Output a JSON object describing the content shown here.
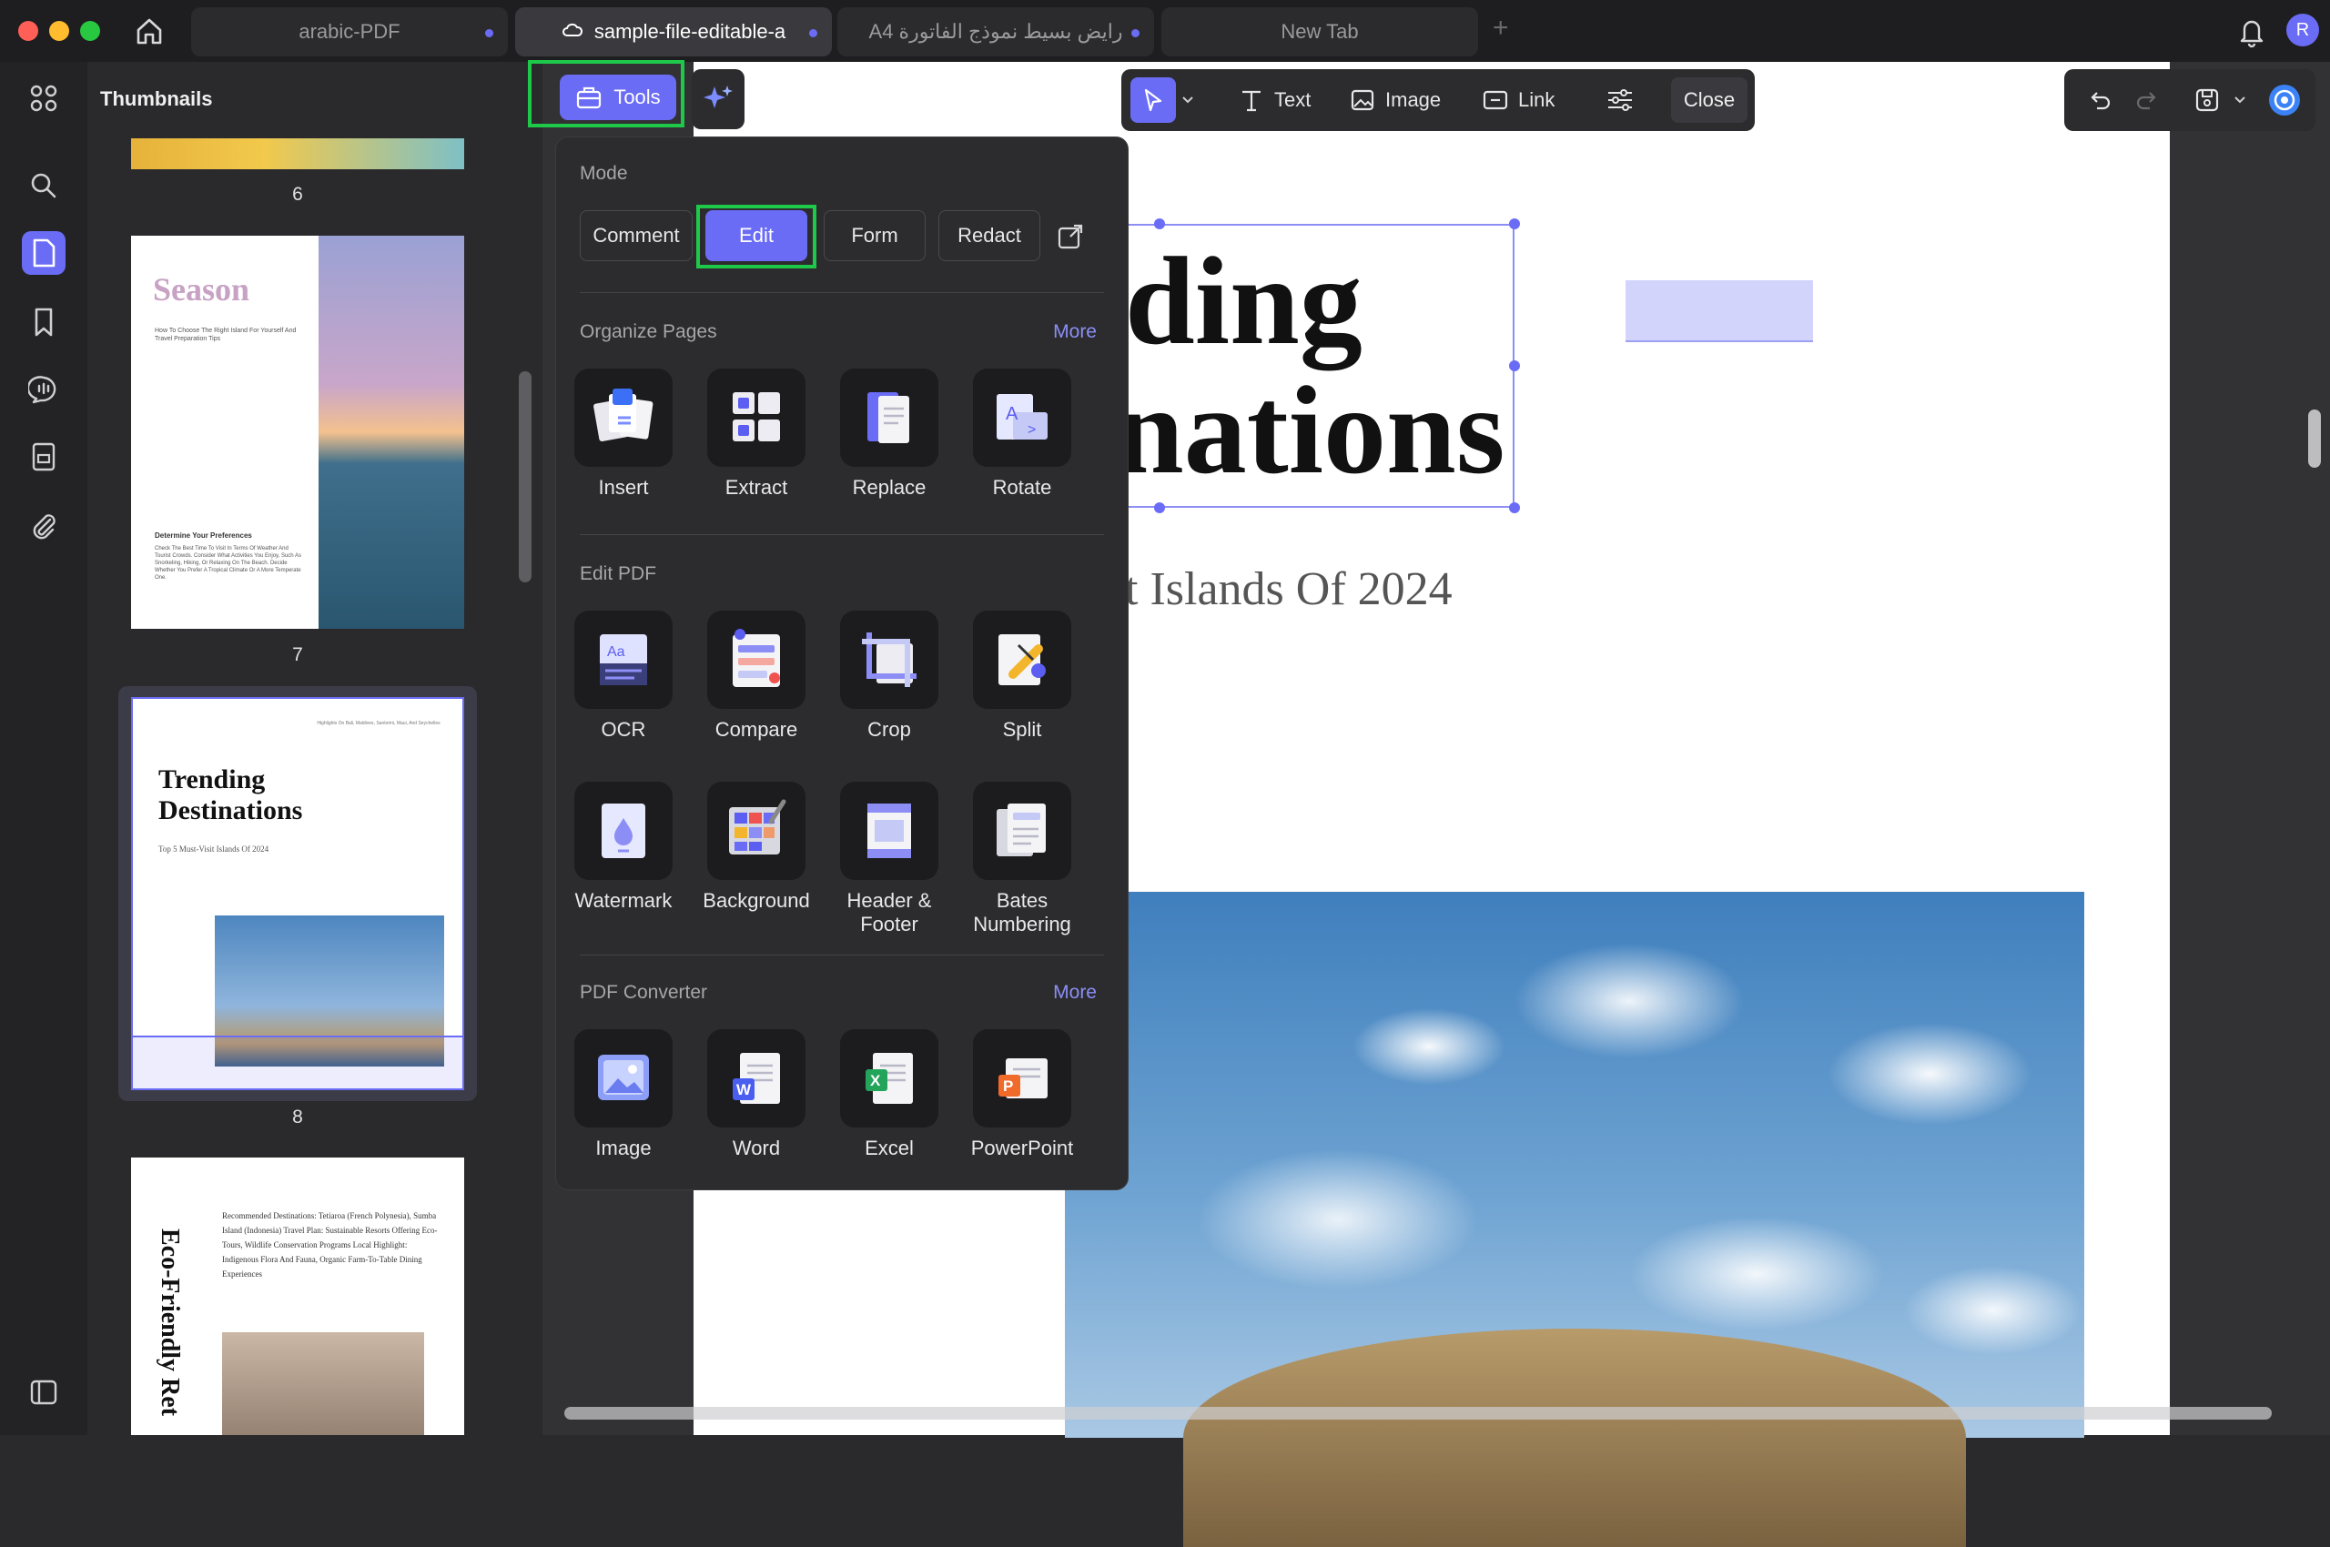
{
  "tabs": [
    {
      "label": "arabic-PDF",
      "active": false
    },
    {
      "label": "sample-file-editable-a",
      "active": true
    },
    {
      "label": "A4 رايض بسيط نموذج الفاتورة",
      "active": false
    },
    {
      "label": "New Tab",
      "active": false
    }
  ],
  "user": {
    "initial": "R"
  },
  "sidebar": {
    "title": "Thumbnails"
  },
  "thumbnails": [
    {
      "number": "6"
    },
    {
      "number": "7",
      "heading": "Season",
      "caption": "How To Choose The Right Island For Yourself And Travel Preparation Tips",
      "subheading": "Determine Your Preferences",
      "body": "Check The Best Time To Visit In Terms Of Weather And Tourist Crowds. Consider What Activities You Enjoy, Such As Snorkeling, Hiking, Or Relaxing On The Beach. Decide Whether You Prefer A Tropical Climate Or A More Temperate One."
    },
    {
      "number": "8",
      "header_text": "Highlights On Bali, Maldives, Santorini, Maui, And Seychelles",
      "title_line1": "Trending",
      "title_line2": "Destinations",
      "subtitle": "Top 5 Must-Visit Islands Of 2024"
    },
    {
      "vertical_title": "Eco-Friendly Ret",
      "text": "Recommended Destinations: Tetiaroa (French Polynesia), Sumba Island (Indonesia) Travel Plan: Sustainable Resorts Offering Eco-Tours, Wildlife Conservation Programs Local Highlight: Indigenous Flora And Fauna, Organic Farm-To-Table Dining Experiences"
    }
  ],
  "document": {
    "title_line1": "ding",
    "title_line2": "nations",
    "subtitle": "t Islands Of 2024"
  },
  "toolbar": {
    "tools_label": "Tools",
    "text_label": "Text",
    "image_label": "Image",
    "link_label": "Link",
    "close_label": "Close"
  },
  "popover": {
    "mode_title": "Mode",
    "modes": [
      "Comment",
      "Edit",
      "Form",
      "Redact"
    ],
    "active_mode": "Edit",
    "organize_title": "Organize Pages",
    "organize_more": "More",
    "organize_tools": [
      "Insert",
      "Extract",
      "Replace",
      "Rotate"
    ],
    "edit_title": "Edit PDF",
    "edit_tools_row1": [
      "OCR",
      "Compare",
      "Crop",
      "Split"
    ],
    "edit_tools_row2": [
      "Watermark",
      "Background",
      "Header & Footer",
      "Bates Numbering"
    ],
    "converter_title": "PDF Converter",
    "converter_more": "More",
    "converter_tools": [
      "Image",
      "Word",
      "Excel",
      "PowerPoint"
    ]
  },
  "colors": {
    "accent": "#6a6cf6",
    "highlight": "#1ec94a"
  }
}
